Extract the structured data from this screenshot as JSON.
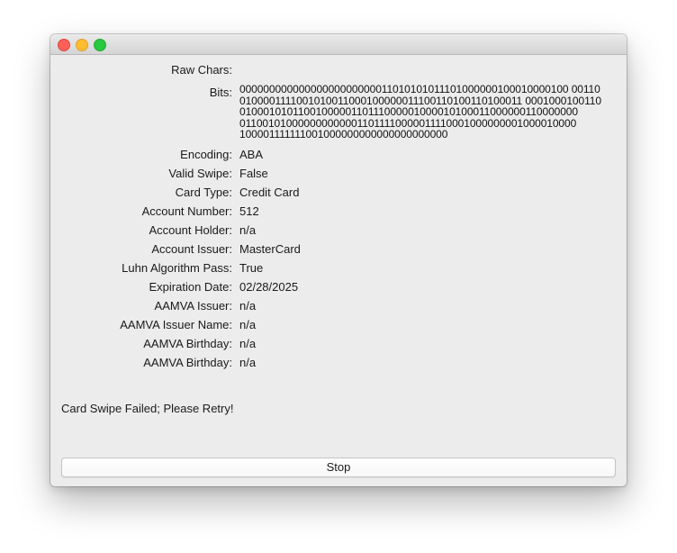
{
  "window": {
    "controls": [
      "close",
      "minimize",
      "zoom"
    ]
  },
  "fields": {
    "raw_chars": {
      "label": "Raw Chars:",
      "value": ""
    },
    "bits": {
      "label": "Bits:",
      "lines": [
        "00000000000000000000000011010101011101000000100010000100 00110",
        "0100001111001010011000100000011100110100110100011 0001000100110",
        "0100010101100100000110111000001000010100011000000110000000",
        "0110010100000000000011011110000011110001000000001000010000",
        "100001111111001000000000000000000000"
      ]
    },
    "encoding": {
      "label": "Encoding:",
      "value": "ABA"
    },
    "valid_swipe": {
      "label": "Valid Swipe:",
      "value": "False"
    },
    "card_type": {
      "label": "Card Type:",
      "value": "Credit Card"
    },
    "account_number": {
      "label": "Account Number:",
      "value": "512"
    },
    "account_holder": {
      "label": "Account Holder:",
      "value": "n/a"
    },
    "account_issuer": {
      "label": "Account Issuer:",
      "value": "MasterCard"
    },
    "luhn": {
      "label": "Luhn Algorithm Pass:",
      "value": "True"
    },
    "expiration": {
      "label": "Expiration Date:",
      "value": "02/28/2025"
    },
    "aamva_issuer": {
      "label": "AAMVA Issuer:",
      "value": "n/a"
    },
    "aamva_issuer_name": {
      "label": "AAMVA Issuer Name:",
      "value": "n/a"
    },
    "aamva_birthday_1": {
      "label": "AAMVA Birthday:",
      "value": "n/a"
    },
    "aamva_birthday_2": {
      "label": "AAMVA Birthday:",
      "value": "n/a"
    }
  },
  "status_text": "Card Swipe Failed; Please Retry!",
  "stop_button_label": "Stop"
}
